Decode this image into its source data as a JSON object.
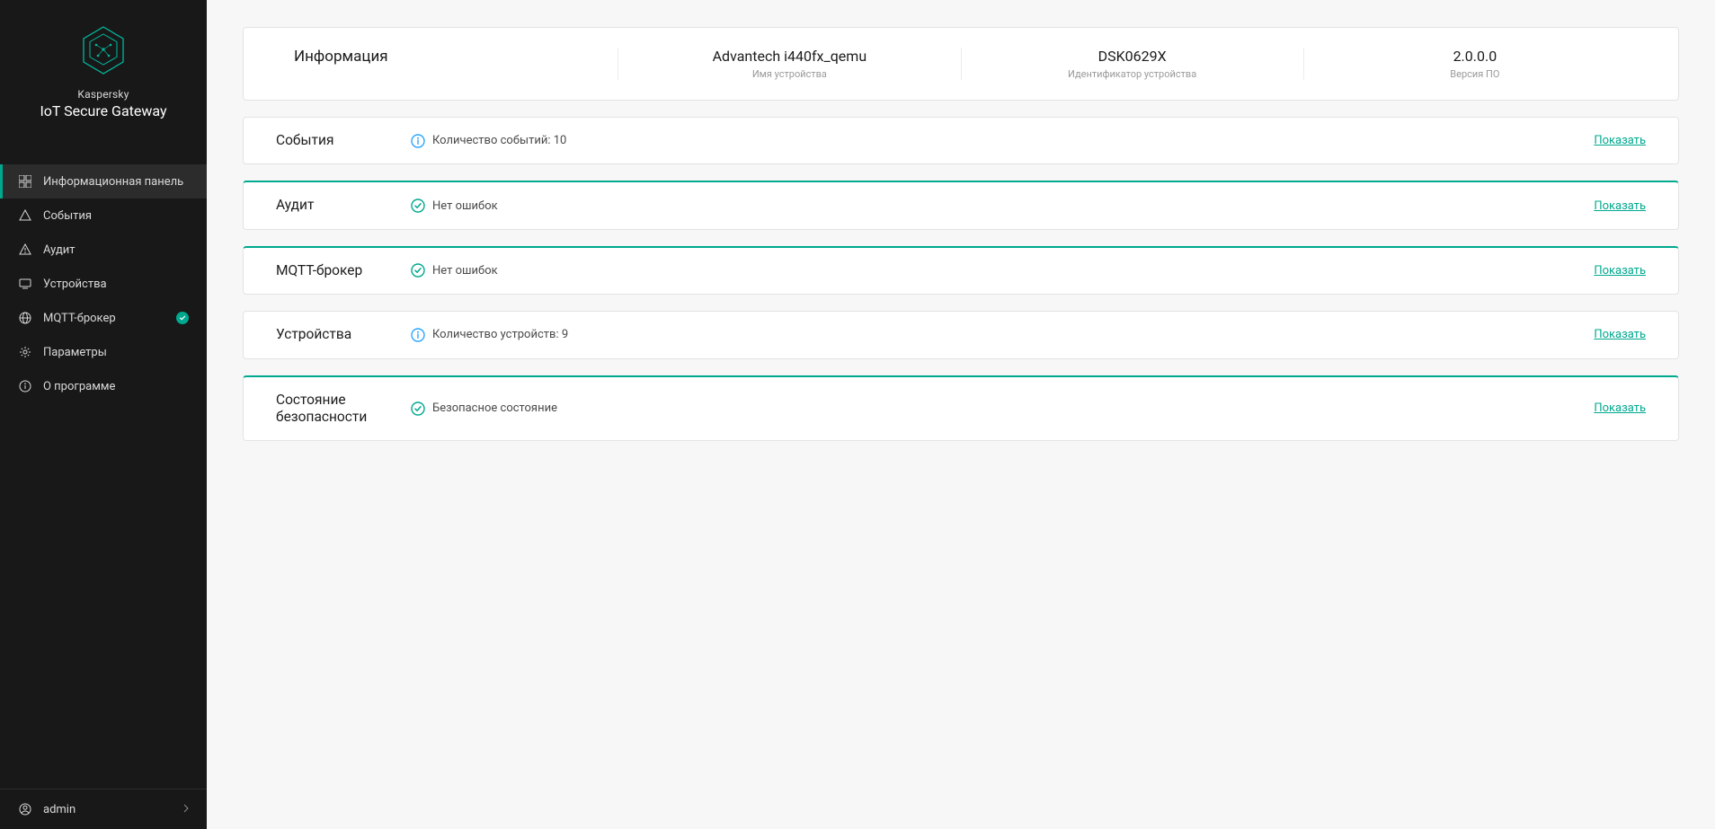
{
  "brand": {
    "line1": "Kaspersky",
    "line2": "IoT Secure Gateway"
  },
  "nav": {
    "items": [
      {
        "label": "Информационная панель"
      },
      {
        "label": "События"
      },
      {
        "label": "Аудит"
      },
      {
        "label": "Устройства"
      },
      {
        "label": "MQTT-брокер"
      },
      {
        "label": "Параметры"
      },
      {
        "label": "О программе"
      }
    ]
  },
  "footer": {
    "user": "admin"
  },
  "info": {
    "title": "Информация",
    "device_name": {
      "value": "Advantech i440fx_qemu",
      "label": "Имя устройства"
    },
    "device_id": {
      "value": "DSK0629X",
      "label": "Идентификатор устройства"
    },
    "version": {
      "value": "2.0.0.0",
      "label": "Версия ПО"
    }
  },
  "rows": {
    "events": {
      "title": "События",
      "text": "Количество событий: 10",
      "link": "Показать",
      "status": "info"
    },
    "audit": {
      "title": "Аудит",
      "text": "Нет ошибок",
      "link": "Показать",
      "status": "ok"
    },
    "mqtt": {
      "title": "MQTT-брокер",
      "text": "Нет ошибок",
      "link": "Показать",
      "status": "ok"
    },
    "devices": {
      "title": "Устройства",
      "text": "Количество устройств: 9",
      "link": "Показать",
      "status": "info"
    },
    "security": {
      "title": "Состояние безопасности",
      "text": "Безопасное состояние",
      "link": "Показать",
      "status": "ok"
    }
  },
  "colors": {
    "accent": "#00a88e",
    "info": "#2aa6ff"
  }
}
